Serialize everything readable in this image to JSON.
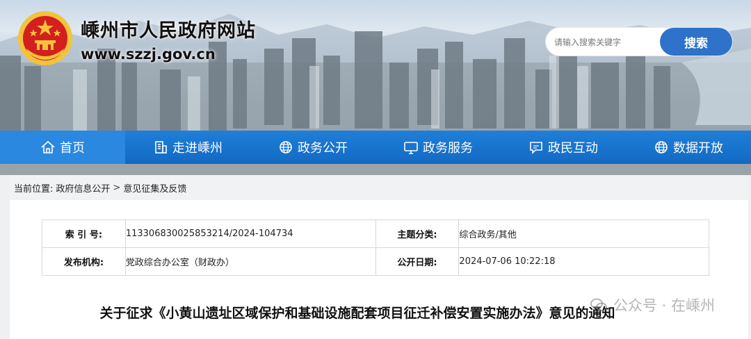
{
  "header": {
    "site_title": "嵊州市人民政府网站",
    "site_url": "www.szzj.gov.cn",
    "search_placeholder": "请输入搜索关键字",
    "search_button": "搜索"
  },
  "nav": {
    "items": [
      {
        "label": "首页",
        "icon": "home-icon"
      },
      {
        "label": "走进嵊州",
        "icon": "building-icon"
      },
      {
        "label": "政务公开",
        "icon": "globe-icon"
      },
      {
        "label": "政务服务",
        "icon": "monitor-icon"
      },
      {
        "label": "政民互动",
        "icon": "chat-icon"
      },
      {
        "label": "数据开放",
        "icon": "globe-icon"
      }
    ],
    "active_index": 0
  },
  "breadcrumb": {
    "prefix": "当前位置:",
    "items": [
      "政府信息公开",
      "意见征集及反馈"
    ],
    "separator": ">"
  },
  "meta_table": {
    "rows": [
      [
        {
          "label": "索 引 号:",
          "value": "113306830025853214/2024-104734"
        },
        {
          "label": "主题分类:",
          "value": "综合政务/其他"
        }
      ],
      [
        {
          "label": "发布机构:",
          "value": "党政综合办公室（财政办）"
        },
        {
          "label": "公开日期:",
          "value": "2024-07-06 10:22:18"
        }
      ]
    ]
  },
  "article": {
    "title": "关于征求《小黄山遗址区域保护和基础设施配套项目征迁补偿安置实施办法》意见的通知"
  },
  "watermark": {
    "text": "公众号 · 在嵊州"
  },
  "colors": {
    "nav_bg": "#1269c4",
    "nav_active": "#2b88e0",
    "search_button": "#2f72c9",
    "emblem_red": "#d41f1f",
    "emblem_gold": "#f3c33b"
  }
}
